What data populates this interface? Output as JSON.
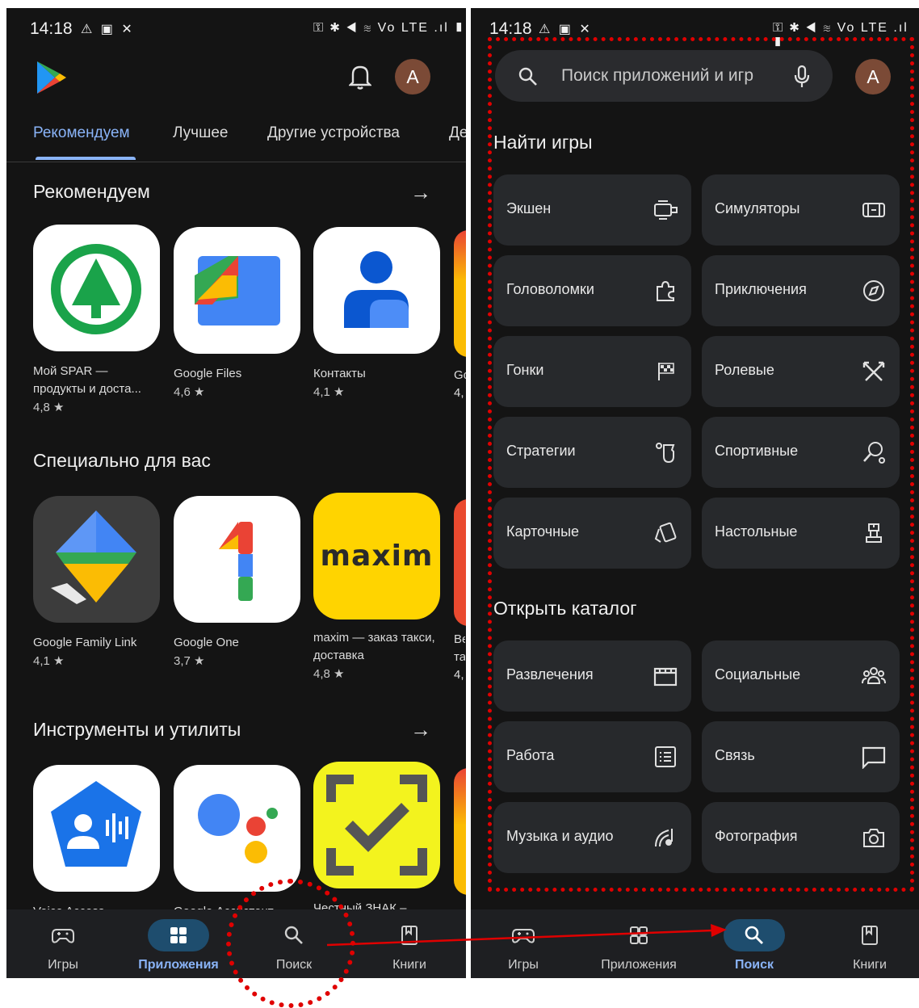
{
  "left": {
    "status": {
      "time": "14:18",
      "left_icons": "⚠ ▣ ✕",
      "right_icons": "⚿ ✱ ◀ ≋ Vo LTE .ıl ▮"
    },
    "avatar_letter": "A",
    "tabs": [
      "Рекомендуем",
      "Лучшее",
      "Другие устройства",
      "Де"
    ],
    "sections": [
      {
        "title": "Рекомендуем",
        "apps": [
          {
            "name": "Мой SPAR — продукты и доста...",
            "rating": "4,8 ★"
          },
          {
            "name": "Google Files",
            "rating": "4,6 ★"
          },
          {
            "name": "Контакты",
            "rating": "4,1 ★"
          },
          {
            "name": "Go",
            "rating": "4,"
          }
        ]
      },
      {
        "title": "Специально для вас",
        "apps": [
          {
            "name": "Google Family Link",
            "rating": "4,1 ★"
          },
          {
            "name": "Google One",
            "rating": "3,7 ★"
          },
          {
            "name": "maxim — заказ такси, доставка",
            "rating": "4,8 ★"
          },
          {
            "name": "Ве та",
            "rating": "4,"
          }
        ],
        "maxim_logo": "maxim"
      },
      {
        "title": "Инструменты и утилиты",
        "apps": [
          {
            "name": "Voice Access"
          },
          {
            "name": "Google Ассистент"
          },
          {
            "name": "Честный ЗНАК –"
          }
        ]
      }
    ],
    "nav": [
      {
        "label": "Игры",
        "active": false
      },
      {
        "label": "Приложения",
        "active": true
      },
      {
        "label": "Поиск",
        "active": false
      },
      {
        "label": "Книги",
        "active": false
      }
    ]
  },
  "right": {
    "status": {
      "time": "14:18",
      "left_icons": "⚠ ▣ ✕",
      "right_icons": "⚿ ✱ ◀ ≋ Vo LTE .ıl ▮"
    },
    "search": {
      "placeholder": "Поиск приложений и игр"
    },
    "avatar_letter": "A",
    "games_title": "Найти игры",
    "games": [
      {
        "label": "Экшен",
        "icon": "action-icon"
      },
      {
        "label": "Симуляторы",
        "icon": "simulator-icon"
      },
      {
        "label": "Головоломки",
        "icon": "puzzle-icon"
      },
      {
        "label": "Приключения",
        "icon": "compass-icon"
      },
      {
        "label": "Гонки",
        "icon": "racing-flag-icon"
      },
      {
        "label": "Ролевые",
        "icon": "swords-icon"
      },
      {
        "label": "Стратегии",
        "icon": "strategy-icon"
      },
      {
        "label": "Спортивные",
        "icon": "sports-icon"
      },
      {
        "label": "Карточные",
        "icon": "cards-icon"
      },
      {
        "label": "Настольные",
        "icon": "board-game-icon"
      }
    ],
    "catalog_title": "Открыть каталог",
    "catalog": [
      {
        "label": "Развлечения",
        "icon": "clapper-icon"
      },
      {
        "label": "Социальные",
        "icon": "people-icon"
      },
      {
        "label": "Работа",
        "icon": "list-icon"
      },
      {
        "label": "Связь",
        "icon": "chat-icon"
      },
      {
        "label": "Музыка и аудио",
        "icon": "music-icon"
      },
      {
        "label": "Фотография",
        "icon": "camera-icon"
      }
    ],
    "nav": [
      {
        "label": "Игры",
        "active": false
      },
      {
        "label": "Приложения",
        "active": false
      },
      {
        "label": "Поиск",
        "active": true
      },
      {
        "label": "Книги",
        "active": false
      }
    ]
  },
  "colors": {
    "background": "#141414",
    "accent": "#8ab4f8",
    "annotation": "#e00000"
  }
}
